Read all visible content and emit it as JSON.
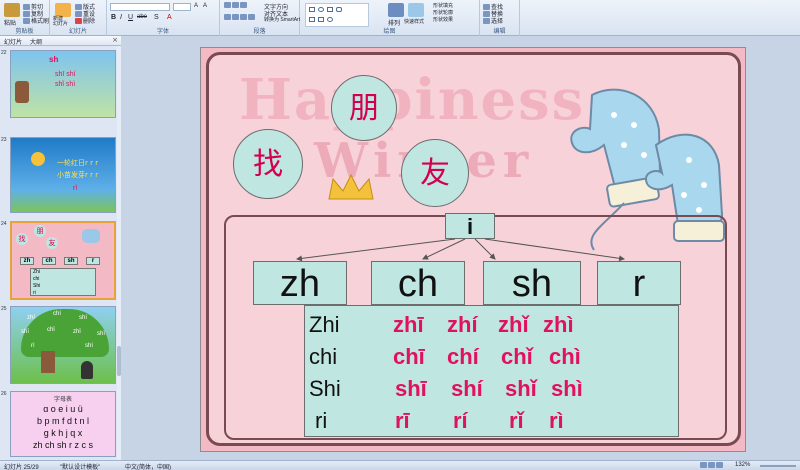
{
  "ribbon": {
    "groups": [
      {
        "title": "剪贴板"
      },
      {
        "title": "幻灯片"
      },
      {
        "title": "字体"
      },
      {
        "title": "段落"
      },
      {
        "title": "绘图"
      },
      {
        "title": "编辑"
      }
    ],
    "paste_label": "粘贴",
    "cut_label": "剪切",
    "copy_label": "复制",
    "format_painter_label": "格式刷",
    "new_slide_label": "新建\n幻灯片",
    "layout_label": "版式",
    "reset_label": "重设",
    "delete_label": "删除",
    "text_direction_label": "文字方向",
    "align_text_label": "对齐文本",
    "smartart_label": "转换为 SmartArt",
    "arrange_label": "排列",
    "quick_styles_label": "快速样式",
    "shape_fill_label": "形状填充",
    "shape_outline_label": "形状轮廓",
    "shape_effects_label": "形状效果",
    "find_label": "查找",
    "replace_label": "替换",
    "select_label": "选择",
    "bold": "B",
    "italic": "I",
    "underline": "U",
    "strike": "abe",
    "shadow": "S"
  },
  "pane": {
    "tab_slides": "幻灯片",
    "tab_outline": "大纲",
    "close_glyph": "×",
    "thumbnails": [
      {
        "number": "22",
        "lines": [
          "sh",
          "shī  shí",
          "shǐ  shì"
        ]
      },
      {
        "number": "23",
        "lines": [
          "一轮红日r r r",
          "小苗发芽r r r",
          "rì"
        ]
      },
      {
        "number": "24",
        "lines": [
          "找",
          "朋",
          "友",
          "zh",
          "ch",
          "sh",
          "r",
          "Zhi",
          "chi",
          "Shi",
          "ri"
        ]
      },
      {
        "number": "25",
        "lines": [
          "zhí",
          "chí",
          "shí",
          "shī",
          "chǐ",
          "zhǐ",
          "shì",
          "rì",
          "shí"
        ]
      },
      {
        "number": "26",
        "lines": [
          "字母表",
          "ɑ o e  i u ü",
          "b p m f  d t n l",
          "g k h  j q x",
          "zh ch sh r z c s"
        ]
      }
    ]
  },
  "slide": {
    "banner_line1": "Happiness",
    "banner_line2": "Winter",
    "circles": [
      "找",
      "朋",
      "友"
    ],
    "top_box": "i",
    "initials": [
      "zh",
      "ch",
      "sh",
      "r"
    ],
    "rows": [
      {
        "label": "Zhi",
        "syllables": [
          "zhī",
          "zhí",
          "zhǐ",
          "zhì"
        ]
      },
      {
        "label": "chi",
        "syllables": [
          "chī",
          "chí",
          "chǐ",
          "chì"
        ]
      },
      {
        "label": "Shi",
        "syllables": [
          "shī",
          "shí",
          "shǐ",
          "shì"
        ]
      },
      {
        "label": "ri",
        "syllables": [
          "rī",
          "rí",
          "rǐ",
          "rì"
        ]
      }
    ]
  },
  "status": {
    "slide_count": "幻灯片 25/29",
    "theme": "\"默认设计模板\"",
    "language": "中文(简体，中国)",
    "zoom": "132%"
  },
  "colors": {
    "pinyin": "#e0115f",
    "box_fill": "#bfe6e1",
    "slide_bg": "#f3b9c5"
  }
}
